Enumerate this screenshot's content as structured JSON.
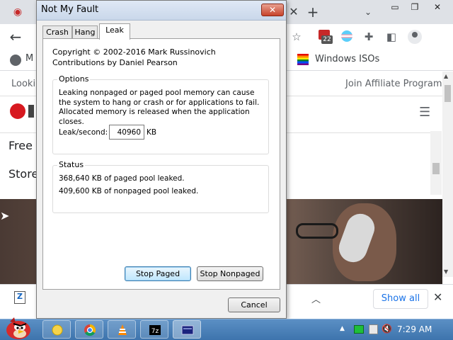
{
  "browser": {
    "bookmarks": {
      "truncated_item": "M",
      "windows_isos": "Windows ISOs",
      "more": "»"
    },
    "extension_badge": "22",
    "page": {
      "looking_text": "Looki",
      "affiliate_link": "Join Affiliate Program",
      "free_text": "Free",
      "store_text": "Store"
    },
    "downloads_bar": {
      "show_all": "Show all",
      "close": "✕"
    }
  },
  "dialog": {
    "title": "Not My Fault",
    "close_label": "✕",
    "tabs": [
      {
        "label": "Crash",
        "active": false
      },
      {
        "label": "Hang",
        "active": false
      },
      {
        "label": "Leak",
        "active": true
      }
    ],
    "copyright_line1": "Copyright © 2002-2016 Mark Russinovich",
    "copyright_line2": "Contributions by Daniel Pearson",
    "options": {
      "label": "Options",
      "description": "Leaking nonpaged or paged pool memory can cause the system to hang or crash or for applications to fail. Allocated memory is released when the application closes.",
      "leak_label": "Leak/second:",
      "leak_value": "40960",
      "leak_unit": "KB"
    },
    "status": {
      "label": "Status",
      "paged": "368,640 KB of paged pool leaked.",
      "nonpaged": "409,600 KB of nonpaged pool leaked."
    },
    "buttons": {
      "stop_paged": "Stop Paged",
      "stop_nonpaged": "Stop Nonpaged",
      "cancel": "Cancel"
    }
  },
  "taskbar": {
    "clock": "7:29 AM",
    "apps": [
      "explorer",
      "chrome",
      "vlc",
      "7-zip",
      "notmyfault"
    ]
  }
}
